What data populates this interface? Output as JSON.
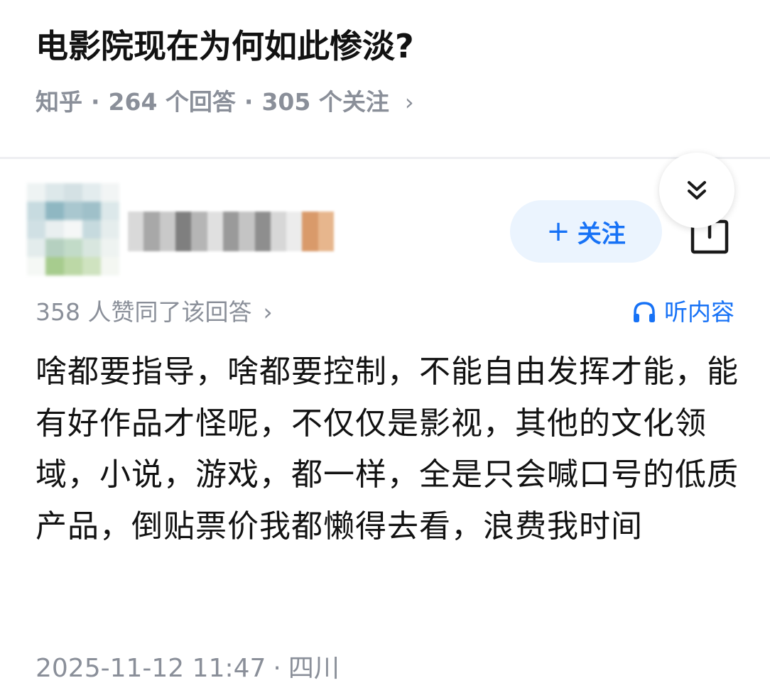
{
  "question": {
    "title": "电影院现在为何如此惨淡?",
    "source": "知乎",
    "answers": "264 个回答",
    "followers": "305 个关注",
    "chevron": "›"
  },
  "answer": {
    "follow_label": "关注",
    "plus_icon": "plus-icon",
    "votes_text": "358 人赞同了该回答",
    "votes_chevron": "›",
    "listen_label": "听内容",
    "listen_icon": "headphones-icon",
    "content": "啥都要指导，啥都要控制，不能自由发挥才能，能有好作品才怪呢，不仅仅是影视，其他的文化领域，小说，游戏，都一样，全是只会喊口号的低质产品，倒贴票价我都懒得去看，浪费我时间",
    "date": "2025-11-12 11:47",
    "location": "四川"
  },
  "icons": {
    "fold": "chevron-double-down-icon",
    "share": "share-icon"
  },
  "colors": {
    "accent": "#1772f6",
    "accent_bg": "#ebf4fe",
    "meta": "#8a8f99",
    "text": "#121212"
  }
}
